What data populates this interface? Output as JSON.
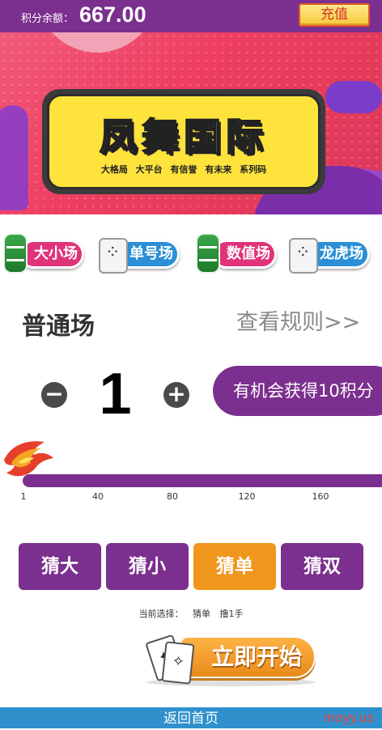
{
  "header": {
    "balance_label": "积分余额：",
    "balance_value": "667.00",
    "recharge_label": "充值"
  },
  "banner": {
    "title": "凤舞国际",
    "subtitle": "大格局 大平台 有信誉 有未来 系列码"
  },
  "modes": [
    {
      "label": "大小场",
      "color": "#e0337a",
      "icon": "chips-icon"
    },
    {
      "label": "单号场",
      "color": "#2a8fd6",
      "icon": "dice-icon"
    },
    {
      "label": "数值场",
      "color": "#e0337a",
      "icon": "chips-icon"
    },
    {
      "label": "龙虎场",
      "color": "#2a8fd6",
      "icon": "dice-icon"
    }
  ],
  "section": {
    "title": "普通场",
    "rules_link": "查看规则>>"
  },
  "stepper": {
    "minus": "−",
    "value": "1",
    "plus": "+",
    "reward_text": "有机会获得10积分"
  },
  "slider": {
    "ticks": [
      "1",
      "40",
      "80",
      "120",
      "160"
    ],
    "value": 1
  },
  "guesses": [
    {
      "label": "猜大",
      "active": false
    },
    {
      "label": "猜小",
      "active": false
    },
    {
      "label": "猜单",
      "active": true
    },
    {
      "label": "猜双",
      "active": false
    }
  ],
  "selection": {
    "prefix": "当前选择：",
    "choice": "猜单",
    "hands": "撸1手"
  },
  "start_label": "立即开始",
  "footer": {
    "home_label": "返回首页",
    "watermark": "moyy.us"
  },
  "colors": {
    "purple": "#7b2f8e",
    "orange": "#f0961c",
    "footer_blue": "#2f90cc"
  }
}
